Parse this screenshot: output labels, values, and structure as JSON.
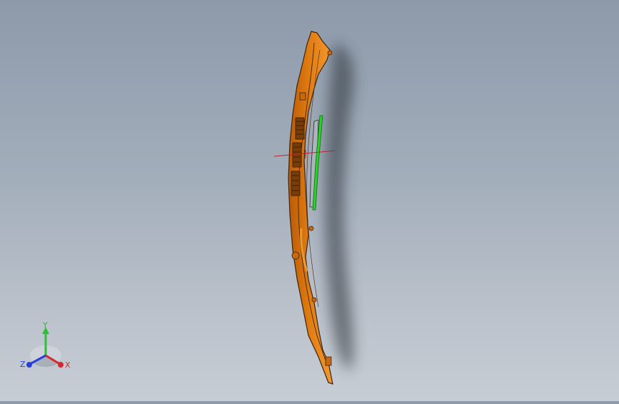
{
  "viewport": {
    "background_top": "#8d9aaa",
    "background_bottom": "#c7cdd5",
    "model": {
      "body_color": "#e07b10",
      "edge_color": "#3a2410",
      "highlight_color": "#f4a23a",
      "insert_color": "#2bd12b",
      "shadow_color": "#2a3038"
    },
    "origin_marker_color": "#c0202a"
  },
  "triad": {
    "labels": {
      "x": "X",
      "y": "Y",
      "z": "Z"
    },
    "colors": {
      "x": "#d8262e",
      "y": "#2fbe3a",
      "z": "#2b3fd8"
    }
  }
}
